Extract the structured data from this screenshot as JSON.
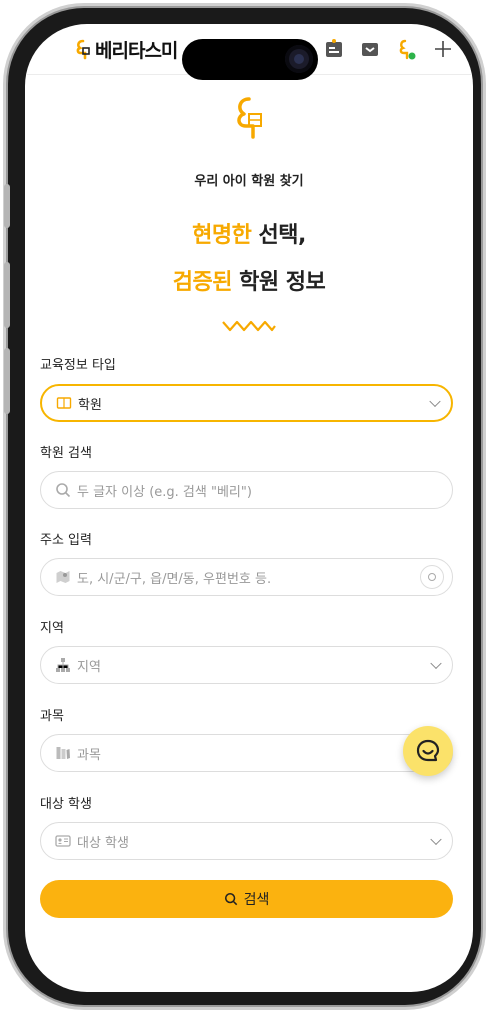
{
  "header": {
    "brand_name": "베리타스미",
    "icons": [
      "beritas-logo-icon",
      "notice-icon",
      "inbox-icon",
      "profile-icon",
      "plus-icon"
    ]
  },
  "hero": {
    "tagline": "우리 아이 학원 찾기",
    "headline_line1_accent": "현명한",
    "headline_line1_rest": " 선택,",
    "headline_line2_accent": "검증된",
    "headline_line2_rest": " 학원 정보"
  },
  "form": {
    "edu_type": {
      "label": "교육정보 타입",
      "value": "학원",
      "icon": "book-icon"
    },
    "academy_search": {
      "label": "학원 검색",
      "placeholder": "두 글자 이상 (e.g. 검색 \"베리\")",
      "icon": "search-icon"
    },
    "address": {
      "label": "주소 입력",
      "placeholder": "도, 시/군/구, 읍/면/동, 우편번호 등.",
      "icon": "map-icon"
    },
    "region": {
      "label": "지역",
      "value": "지역",
      "icon": "hierarchy-icon"
    },
    "subject": {
      "label": "과목",
      "value": "과목",
      "icon": "books-icon"
    },
    "target": {
      "label": "대상 학생",
      "value": "대상 학생",
      "icon": "id-card-icon"
    },
    "search_button": "검색"
  },
  "colors": {
    "accent": "#f7a900",
    "button": "#fbb20f",
    "fab": "#fbe26a"
  }
}
